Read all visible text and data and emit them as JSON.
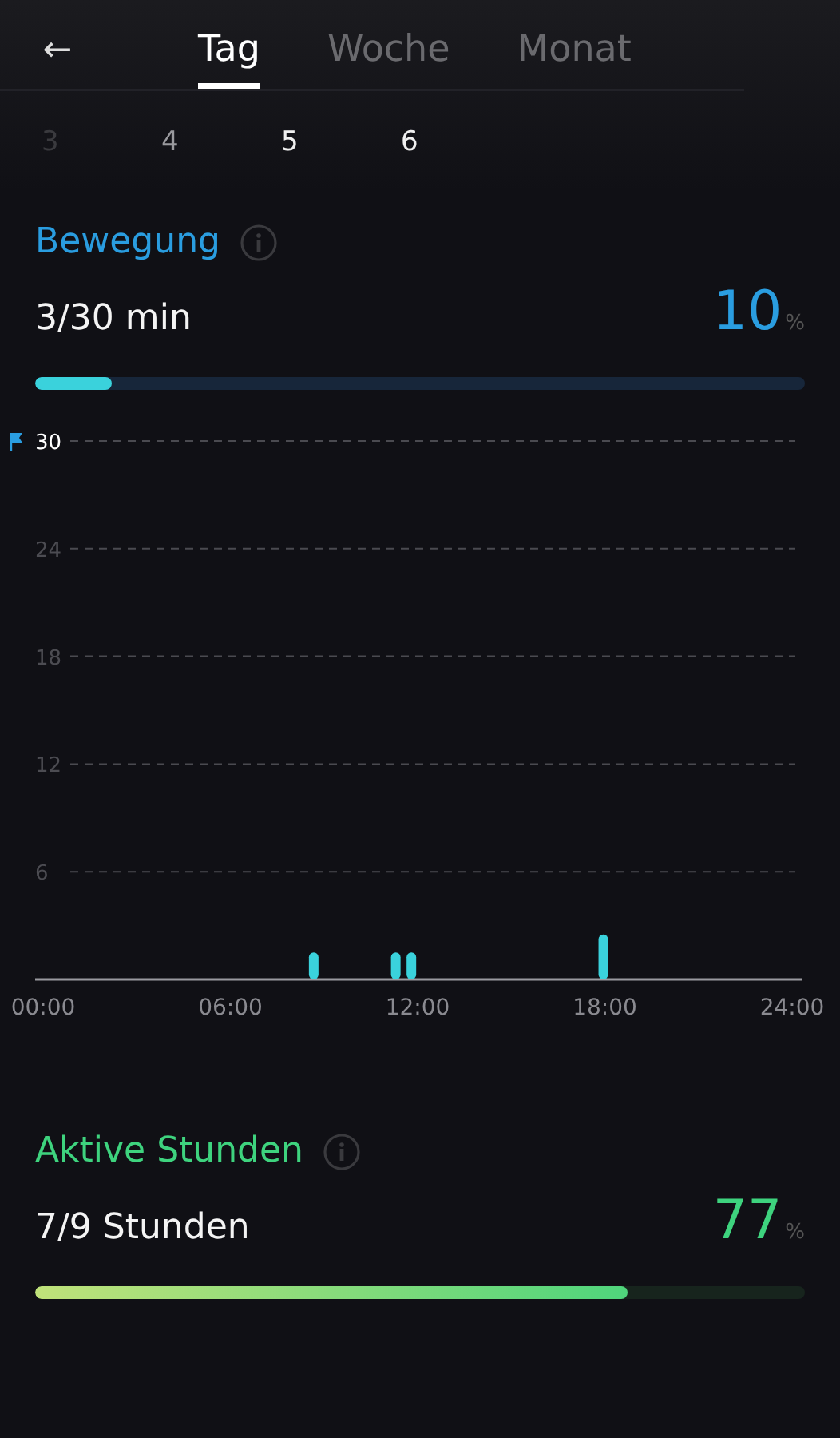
{
  "header": {
    "back_label": "←",
    "tabs": [
      {
        "label": "Tag",
        "selected": true
      },
      {
        "label": "Woche",
        "selected": false
      },
      {
        "label": "Monat",
        "selected": false
      }
    ]
  },
  "days": [
    "3",
    "4",
    "5",
    "6"
  ],
  "sections": [
    {
      "kind": "movement",
      "title": "Bewegung",
      "value": "3/30 min",
      "percent": "10",
      "unit": "%",
      "level": 0.1,
      "color": "#2a9de0",
      "chart_data": {
        "type": "bar",
        "x": [
          8.67,
          11.3,
          11.8,
          17.95
        ],
        "values": [
          1.5,
          1.5,
          1.5,
          2.5
        ],
        "xlim": [
          0,
          24
        ],
        "ylim": [
          0,
          30
        ],
        "xticks": [
          {
            "value": 0,
            "label": "00:00"
          },
          {
            "value": 6,
            "label": "06:00"
          },
          {
            "value": 12,
            "label": "12:00"
          },
          {
            "value": 18,
            "label": "18:00"
          },
          {
            "value": 24,
            "label": "24:00"
          }
        ],
        "yticks": [
          6,
          12,
          18,
          24,
          30
        ],
        "grid": true
      },
      "goal_flag": true
    },
    {
      "kind": "hours",
      "title": "Aktive Stunden",
      "value": "7/9 Stunden",
      "percent": "77",
      "unit": "%",
      "level": 0.77,
      "color": "#3ed37e"
    }
  ]
}
